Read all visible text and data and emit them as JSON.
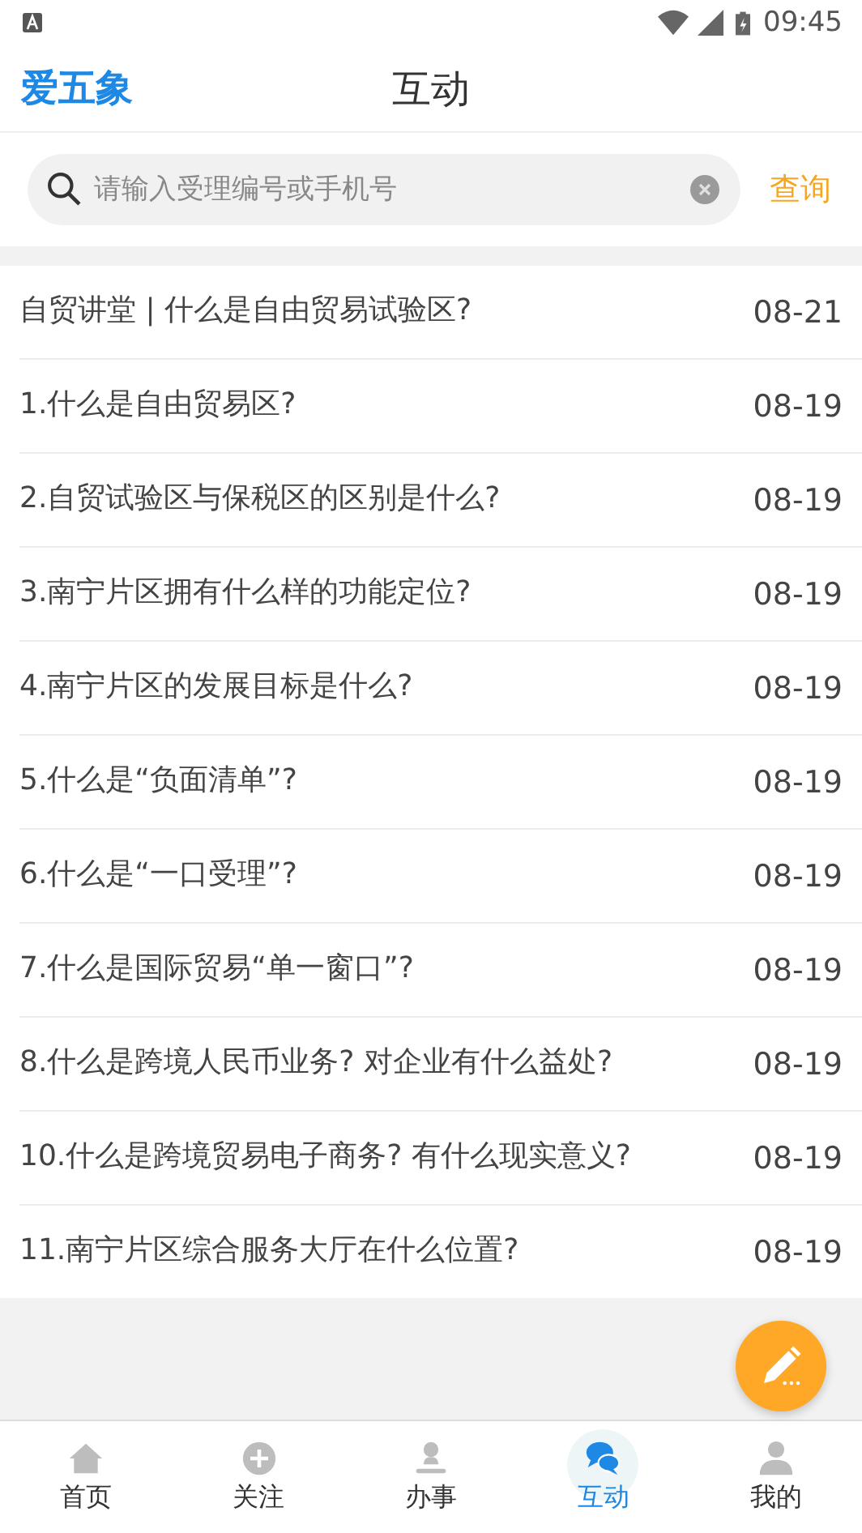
{
  "status_bar": {
    "time": "09:45"
  },
  "header": {
    "logo": "爱五象",
    "title": "互动"
  },
  "search": {
    "placeholder": "请输入受理编号或手机号",
    "button": "查询"
  },
  "articles": [
    {
      "title": "自贸讲堂 | 什么是自由贸易试验区?",
      "date": "08-21"
    },
    {
      "title": "1.什么是自由贸易区?",
      "date": "08-19"
    },
    {
      "title": "2.自贸试验区与保税区的区别是什么?",
      "date": "08-19"
    },
    {
      "title": "3.南宁片区拥有什么样的功能定位?",
      "date": "08-19"
    },
    {
      "title": "4.南宁片区的发展目标是什么?",
      "date": "08-19"
    },
    {
      "title": "5.什么是“负面清单”?",
      "date": "08-19"
    },
    {
      "title": "6.什么是“一口受理”?",
      "date": "08-19"
    },
    {
      "title": "7.什么是国际贸易“单一窗口”?",
      "date": "08-19"
    },
    {
      "title": "8.什么是跨境人民币业务? 对企业有什么益处?",
      "date": "08-19"
    },
    {
      "title": "10.什么是跨境贸易电子商务? 有什么现实意义?",
      "date": "08-19"
    },
    {
      "title": "11.南宁片区综合服务大厅在什么位置?",
      "date": "08-19"
    }
  ],
  "tabs": [
    {
      "label": "首页",
      "selected": false
    },
    {
      "label": "关注",
      "selected": false
    },
    {
      "label": "办事",
      "selected": false
    },
    {
      "label": "互动",
      "selected": true
    },
    {
      "label": "我的",
      "selected": false
    }
  ]
}
